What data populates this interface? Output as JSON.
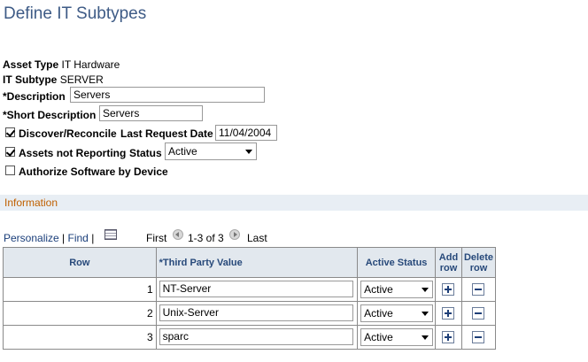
{
  "page": {
    "title": "Define IT Subtypes"
  },
  "fields": {
    "asset_type_label": "Asset Type",
    "asset_type_value": "IT Hardware",
    "it_subtype_label": "IT Subtype",
    "it_subtype_value": "SERVER",
    "description_label": "*Description",
    "description_value": "Servers",
    "short_description_label": "*Short Description",
    "short_description_value": "Servers",
    "discover_label": "Discover/Reconcile",
    "discover_checked": true,
    "last_request_label": "Last Request Date",
    "last_request_value": "11/04/2004",
    "assets_not_reporting_label": "Assets not Reporting",
    "assets_not_reporting_checked": true,
    "status_label": "Status",
    "status_value": "Active",
    "authorize_label": "Authorize Software by Device",
    "authorize_checked": false
  },
  "section": {
    "title": "Information"
  },
  "grid_nav": {
    "personalize": "Personalize",
    "find": "Find",
    "separator": "|",
    "first": "First",
    "range": "1-3 of 3",
    "last": "Last"
  },
  "grid": {
    "headers": {
      "row": "Row",
      "third_party": "*Third Party Value",
      "active_status": "Active Status",
      "add_row": "Add row",
      "delete_row": "Delete row"
    },
    "rows": [
      {
        "row": "1",
        "value": "NT-Server",
        "status": "Active"
      },
      {
        "row": "2",
        "value": "Unix-Server",
        "status": "Active"
      },
      {
        "row": "3",
        "value": "sparc",
        "status": "Active"
      }
    ]
  },
  "icons": {
    "grid_icon": "download-grid-icon",
    "prev": "previous-arrow-icon",
    "next": "next-arrow-icon",
    "add": "plus-icon",
    "delete": "minus-icon"
  },
  "colors": {
    "title": "#3e5b86",
    "section_title": "#c06000",
    "header_bg": "#e2e8ee",
    "section_bar": "#e8eef4"
  }
}
